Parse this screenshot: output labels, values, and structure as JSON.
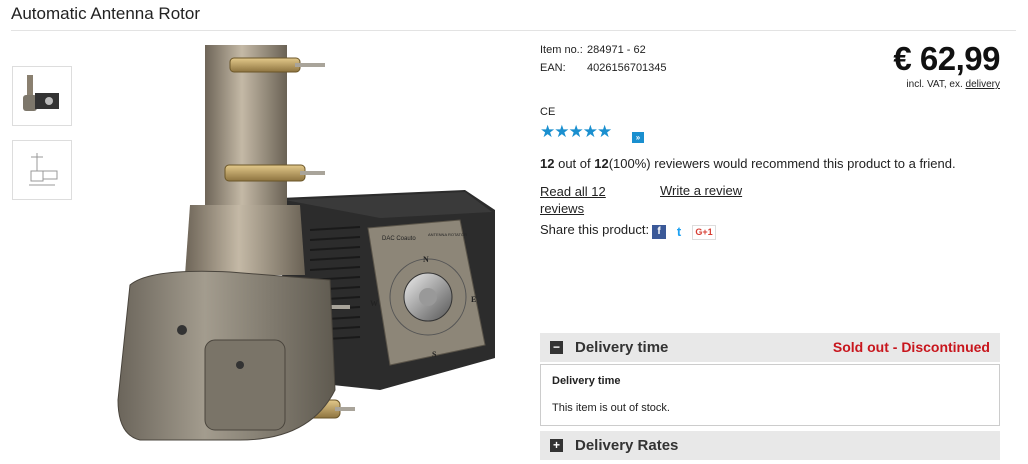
{
  "product": {
    "title": "Automatic Antenna Rotor",
    "item_no_label": "Item no.:",
    "item_no": "284971 - 62",
    "ean_label": "EAN:",
    "ean": "4026156701345",
    "price": "€ 62,99",
    "vat_text": "incl. VAT, ex.",
    "delivery_link": "delivery",
    "ce": "CE",
    "stars": "★★★★★",
    "rating_fraction": 1.0,
    "more_icon": "»"
  },
  "reviews": {
    "count_a": "12",
    "out_of": "out of",
    "count_b": "12",
    "percent": "(100%)",
    "recommend_text": "reviewers would recommend this product to a friend.",
    "read_all": "Read all 12 reviews",
    "write": "Write a review"
  },
  "share": {
    "label": "Share this product:",
    "facebook": "f",
    "twitter": "t",
    "gplus": "G+1"
  },
  "delivery": {
    "bar_label": "Delivery time",
    "bar_icon": "−",
    "status": "Sold out - Discontinued",
    "box_heading": "Delivery time",
    "box_text": "This item is out of stock."
  },
  "rates": {
    "bar_label": "Delivery Rates",
    "bar_icon": "+"
  },
  "device": {
    "brand": "DAC Coauto",
    "panel_label": "ANTENNA ROTATOR",
    "compass": [
      "N",
      "E",
      "S",
      "W"
    ]
  },
  "colors": {
    "accent_blue": "#1a8fcf",
    "status_red": "#c8161d",
    "bar_grey": "#e8e8e8"
  }
}
